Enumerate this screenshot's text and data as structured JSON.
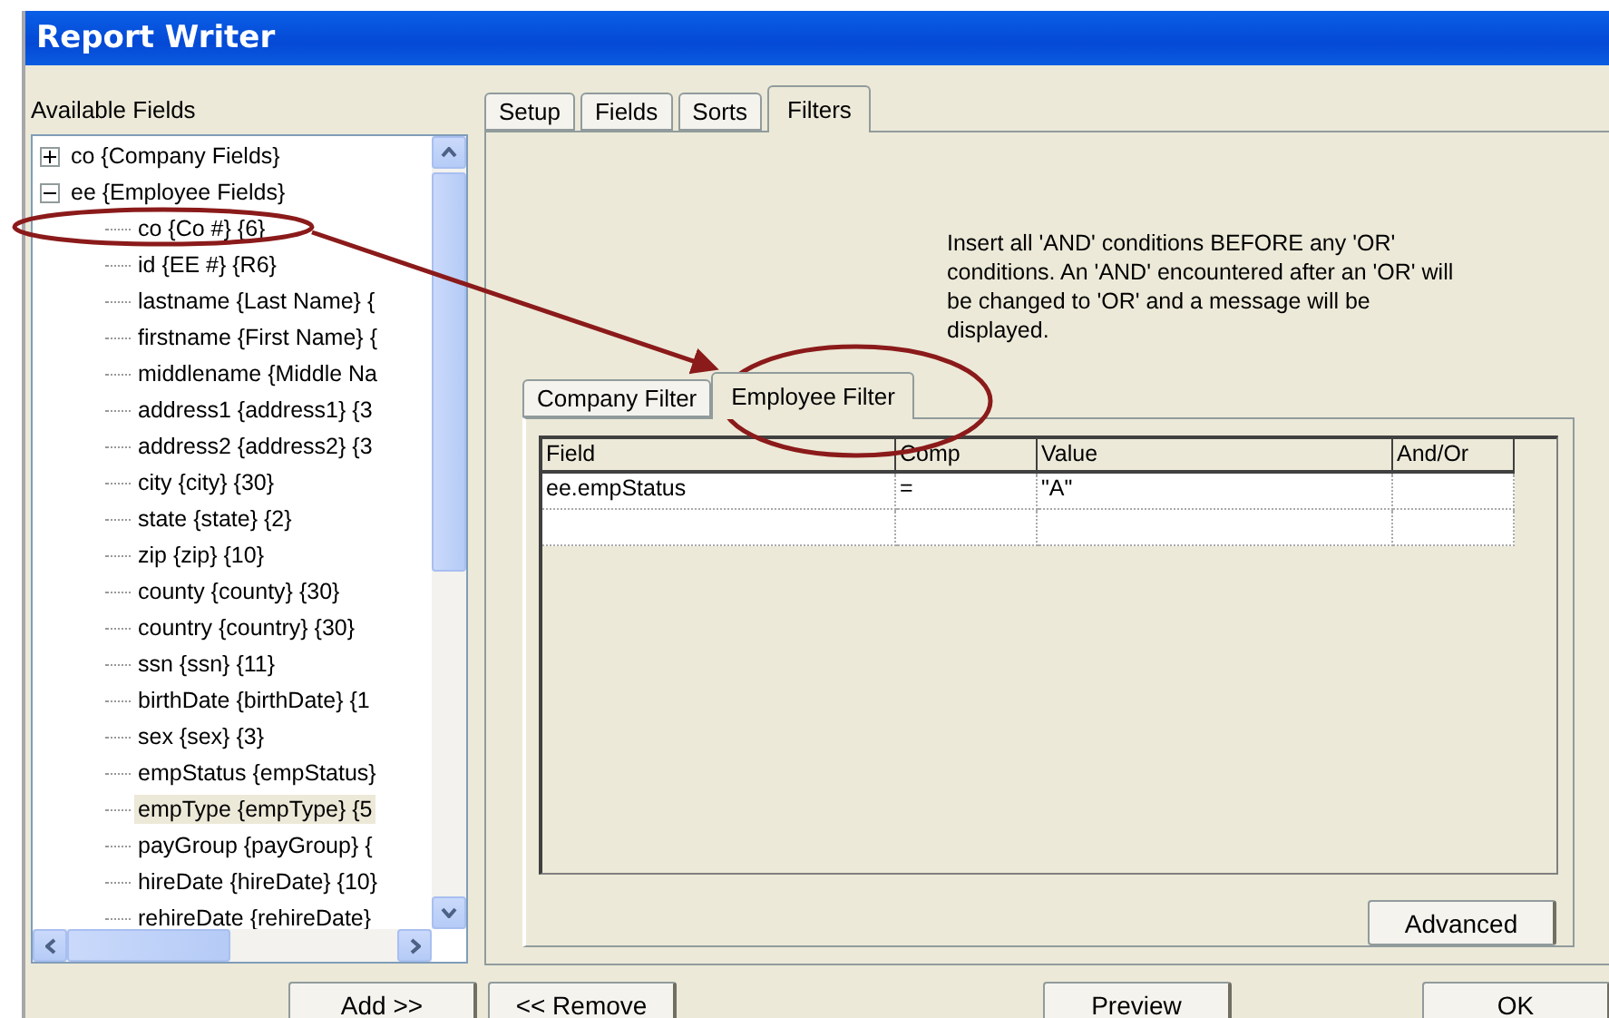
{
  "window": {
    "title": "Report Writer"
  },
  "available_fields": {
    "label": "Available Fields",
    "tree": [
      {
        "label": "co {Company Fields}",
        "expanded": false,
        "selected": false
      },
      {
        "label": "ee {Employee Fields}",
        "expanded": true,
        "selected": false,
        "children": [
          {
            "label": "co {Co #} {6}",
            "selected": false
          },
          {
            "label": "id {EE #} {R6}",
            "selected": false
          },
          {
            "label": "lastname {Last Name} {",
            "selected": false
          },
          {
            "label": "firstname {First Name} {",
            "selected": false
          },
          {
            "label": "middlename {Middle Na",
            "selected": false
          },
          {
            "label": "address1 {address1} {3",
            "selected": false
          },
          {
            "label": "address2 {address2} {3",
            "selected": false
          },
          {
            "label": "city {city} {30}",
            "selected": false
          },
          {
            "label": "state {state} {2}",
            "selected": false
          },
          {
            "label": "zip {zip} {10}",
            "selected": false
          },
          {
            "label": "county {county} {30}",
            "selected": false
          },
          {
            "label": "country {country} {30}",
            "selected": false
          },
          {
            "label": "ssn {ssn} {11}",
            "selected": false
          },
          {
            "label": "birthDate {birthDate} {1",
            "selected": false
          },
          {
            "label": "sex {sex} {3}",
            "selected": false
          },
          {
            "label": "empStatus {empStatus}",
            "selected": false
          },
          {
            "label": "empType {empType} {5",
            "selected": true
          },
          {
            "label": "payGroup {payGroup} {",
            "selected": false
          },
          {
            "label": "hireDate {hireDate} {10}",
            "selected": false
          },
          {
            "label": "rehireDate {rehireDate}",
            "selected": false
          }
        ]
      }
    ]
  },
  "tabs": [
    {
      "label": "Setup",
      "selected": false
    },
    {
      "label": "Fields",
      "selected": false
    },
    {
      "label": "Sorts",
      "selected": false
    },
    {
      "label": "Filters",
      "selected": true
    }
  ],
  "instructions": "Insert all 'AND' conditions BEFORE any 'OR' conditions. An 'AND' encountered after an 'OR' will be changed to 'OR' and a message will be displayed.",
  "filter_tabs": [
    {
      "label": "Company Filter",
      "selected": false
    },
    {
      "label": "Employee Filter",
      "selected": true
    }
  ],
  "table": {
    "columns": [
      "Field",
      "Comp",
      "Value",
      "And/Or"
    ],
    "rows": [
      [
        "ee.empStatus",
        "=",
        "\"A\"",
        null
      ]
    ]
  },
  "advanced_button": "Advanced",
  "buttons": [
    "Add >>",
    "<< Remove",
    "Preview",
    "OK"
  ]
}
